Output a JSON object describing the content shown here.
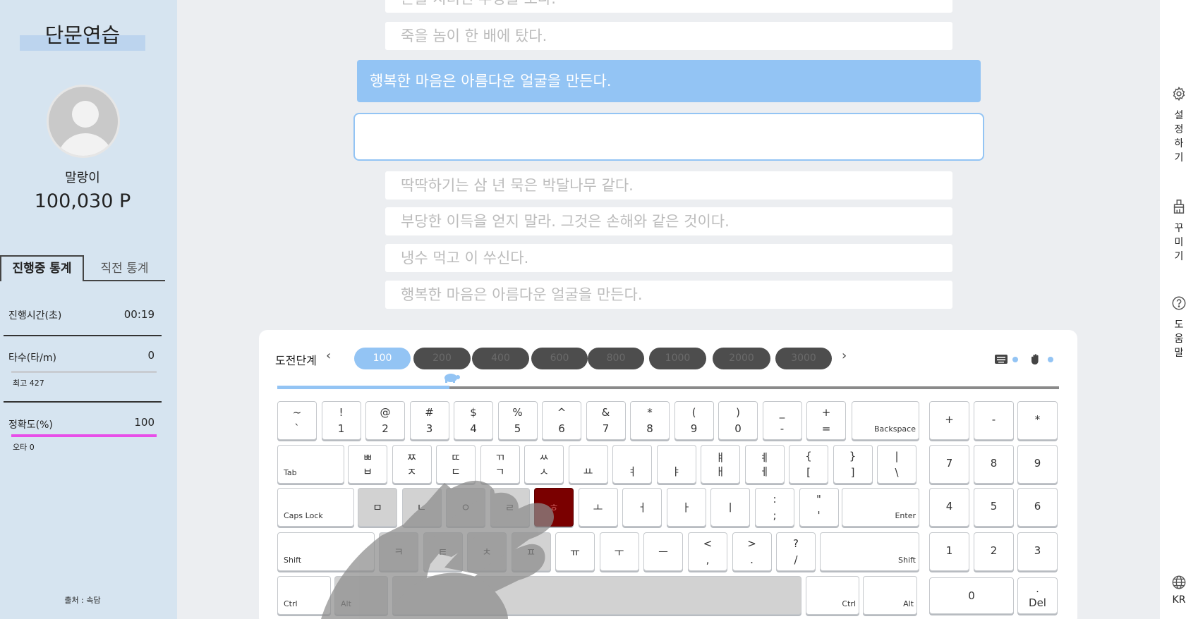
{
  "sidebar": {
    "title": "단문연습",
    "user_name": "말랑이",
    "points": "100,030 P",
    "tabs": [
      "진행중 통계",
      "직전 통계"
    ],
    "stats": {
      "time_label": "진행시간(초)",
      "time_value": "00:19",
      "speed_label": "타수(타/m)",
      "speed_value": "0",
      "best_label": "최고 427",
      "accuracy_label": "정확도(%)",
      "accuracy_value": "100",
      "accuracy_fraction": 1.0,
      "typo_label": "오타 0"
    },
    "source": "출처 : 속담"
  },
  "sentences": {
    "prev": [
      "돈을 지녀면 부정을 보다.",
      "죽을 놈이 한 배에 탔다."
    ],
    "current": "행복한 마음은 아름다운 얼굴을 만든다.",
    "input_value": "",
    "next": [
      "딱딱하기는 삼 년 묵은 박달나무 같다.",
      "부당한 이득을 얻지 말라. 그것은 손해와 같은 것이다.",
      "냉수 먹고 이 쑤신다.",
      "행복한 마음은 아름다운 얼굴을 만든다."
    ]
  },
  "rail": {
    "settings": "설정하기",
    "decorate": "꾸미기",
    "help": "도움말",
    "lang": "KR"
  },
  "keyboard": {
    "challenge_label": "도전단계",
    "prev_icon": "chevron-left-icon",
    "next_icon": "chevron-right-icon",
    "levels": [
      "100",
      "200",
      "400",
      "600",
      "800",
      "1000",
      "2000",
      "3000"
    ],
    "active_level": "100",
    "progress_fraction": 0.22,
    "accent": "#93c4f4",
    "hot_key_color": "#7a0000",
    "row1": [
      [
        "~",
        "`"
      ],
      [
        "!",
        "1"
      ],
      [
        "@",
        "2"
      ],
      [
        "#",
        "3"
      ],
      [
        "$",
        "4"
      ],
      [
        "%",
        "5"
      ],
      [
        "^",
        "6"
      ],
      [
        "&",
        "7"
      ],
      [
        "*",
        "8"
      ],
      [
        "(",
        "9"
      ],
      [
        ")",
        "0"
      ],
      [
        "_",
        "-"
      ],
      [
        "+",
        "="
      ]
    ],
    "backspace": "Backspace",
    "tab": "Tab",
    "row2": [
      [
        "ㅃ",
        "ㅂ"
      ],
      [
        "ㅉ",
        "ㅈ"
      ],
      [
        "ㄸ",
        "ㄷ"
      ],
      [
        "ㄲ",
        "ㄱ"
      ],
      [
        "ㅆ",
        "ㅅ"
      ],
      [
        "",
        "ㅛ"
      ],
      [
        "",
        "ㅕ"
      ],
      [
        "",
        "ㅑ"
      ],
      [
        "ㅒ",
        "ㅐ"
      ],
      [
        "ㅖ",
        "ㅔ"
      ],
      [
        "{",
        "["
      ],
      [
        "}",
        "]"
      ],
      [
        "|",
        "\\"
      ]
    ],
    "caps": "Caps Lock",
    "row3": [
      "ㅁ",
      "ㄴ",
      "ㅇ",
      "ㄹ",
      "ㅎ",
      "ㅗ",
      "ㅓ",
      "ㅏ",
      "ㅣ"
    ],
    "row3_sym": [
      [
        ":",
        ";"
      ],
      [
        "\"",
        "'"
      ]
    ],
    "enter": "Enter",
    "shift": "Shift",
    "row4": [
      "ㅋ",
      "ㅌ",
      "ㅊ",
      "ㅍ",
      "ㅠ",
      "ㅜ",
      "ㅡ"
    ],
    "row4_sym": [
      [
        "<",
        ","
      ],
      [
        ">",
        "."
      ],
      [
        "?",
        "/"
      ]
    ],
    "ctrl": "Ctrl",
    "alt": "Alt",
    "numpad": [
      [
        "+",
        "-",
        "*"
      ],
      [
        "7",
        "8",
        "9"
      ],
      [
        "4",
        "5",
        "6"
      ],
      [
        "1",
        "2",
        "3"
      ]
    ],
    "num_zero": "0",
    "num_del_top": ".",
    "num_del": "Del"
  }
}
